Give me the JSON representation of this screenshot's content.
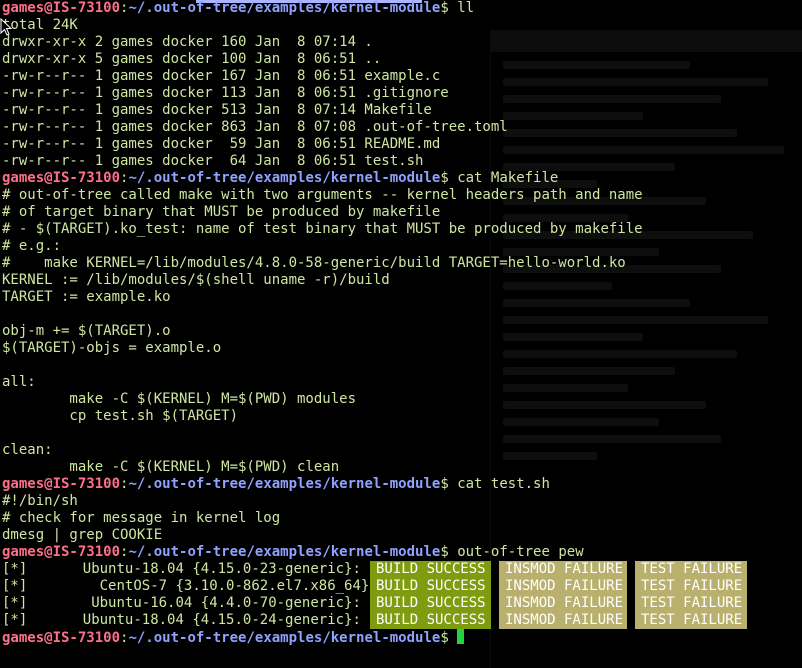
{
  "terminal": {
    "prompt_user": "games@IS-73100",
    "prompt_sep": ":",
    "prompt_path": "~/.out-of-tree/examples/kernel-module",
    "prompt_symbol": "$",
    "colors": {
      "user": "#ff6f8a",
      "path": "#8fa2ff",
      "text": "#cfe6a2",
      "success": "#7f9c10",
      "failure": "#b9b06e",
      "cursor": "#23d43f"
    },
    "icons": {
      "mouse_pointer": "arrow-cursor-icon",
      "text_cursor": "block-cursor"
    },
    "cmd1": "ll",
    "ll_output": [
      "total 24K",
      "drwxr-xr-x 2 games docker 160 Jan  8 07:14 .",
      "drwxr-xr-x 5 games docker 100 Jan  8 06:51 ..",
      "-rw-r--r-- 1 games docker 167 Jan  8 06:51 example.c",
      "-rw-r--r-- 1 games docker 113 Jan  8 06:51 .gitignore",
      "-rw-r--r-- 1 games docker 513 Jan  8 07:14 Makefile",
      "-rw-r--r-- 1 games docker 863 Jan  8 07:08 .out-of-tree.toml",
      "-rw-r--r-- 1 games docker  59 Jan  8 06:51 README.md",
      "-rw-r--r-- 1 games docker  64 Jan  8 06:51 test.sh"
    ],
    "cmd2": "cat Makefile",
    "makefile_lines": [
      "# out-of-tree called make with two arguments -- kernel headers path and name",
      "# of target binary that MUST be produced by makefile",
      "# - $(TARGET).ko_test: name of test binary that MUST be produced by makefile",
      "# e.g.:",
      "#    make KERNEL=/lib/modules/4.8.0-58-generic/build TARGET=hello-world.ko",
      "KERNEL := /lib/modules/$(shell uname -r)/build",
      "TARGET := example.ko",
      "",
      "obj-m += $(TARGET).o",
      "$(TARGET)-objs = example.o",
      "",
      "all:",
      "        make -C $(KERNEL) M=$(PWD) modules",
      "        cp test.sh $(TARGET)",
      "",
      "clean:",
      "        make -C $(KERNEL) M=$(PWD) clean"
    ],
    "cmd3": "cat test.sh",
    "testsh_lines": [
      "#!/bin/sh",
      "# check for message in kernel log",
      "dmesg | grep COOKIE"
    ],
    "cmd4": "out-of-tree pew",
    "results": [
      {
        "mark": "[*]",
        "label": "      Ubuntu-18.04 {4.15.0-23-generic}:",
        "build": "BUILD SUCCESS",
        "insmod": "INSMOD FAILURE",
        "test": "TEST FAILURE"
      },
      {
        "mark": "[*]",
        "label": "        CentOS-7 {3.10.0-862.el7.x86_64}:",
        "build": "BUILD SUCCESS",
        "insmod": "INSMOD FAILURE",
        "test": "TEST FAILURE"
      },
      {
        "mark": "[*]",
        "label": "       Ubuntu-16.04 {4.4.0-70-generic}:",
        "build": "BUILD SUCCESS",
        "insmod": "INSMOD FAILURE",
        "test": "TEST FAILURE"
      },
      {
        "mark": "[*]",
        "label": "      Ubuntu-18.04 {4.15.0-24-generic}:",
        "build": "BUILD SUCCESS",
        "insmod": "INSMOD FAILURE",
        "test": "TEST FAILURE"
      }
    ]
  }
}
